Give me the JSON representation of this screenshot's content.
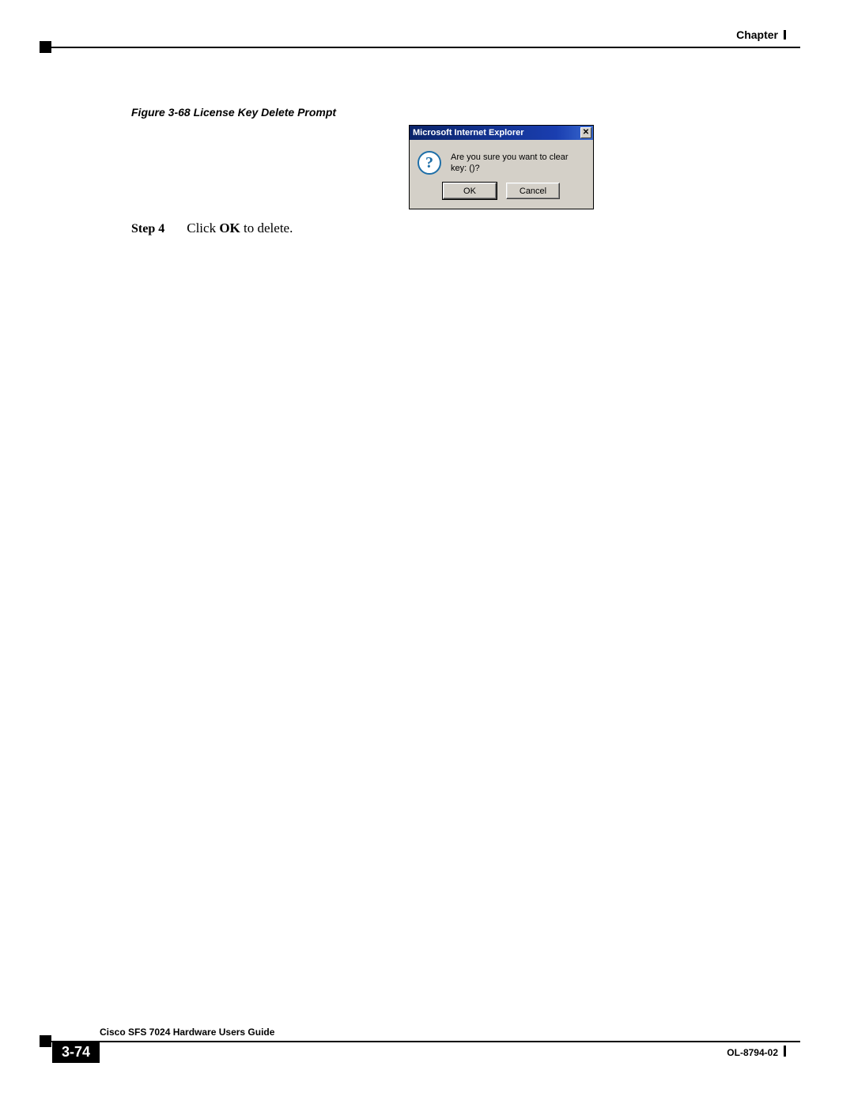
{
  "header": {
    "chapter_label": "Chapter"
  },
  "figure": {
    "caption": "Figure 3-68   License Key Delete Prompt"
  },
  "dialog": {
    "title": "Microsoft Internet Explorer",
    "close_glyph": "✕",
    "question_mark": "?",
    "message": "Are you sure you want to clear key: ()?",
    "ok_label": "OK",
    "cancel_label": "Cancel"
  },
  "step": {
    "label": "Step 4",
    "text_prefix": "Click ",
    "text_bold": "OK",
    "text_suffix": " to delete."
  },
  "footer": {
    "guide": "Cisco SFS 7024 Hardware Users Guide",
    "page_num": "3-74",
    "doc_id": "OL-8794-02"
  }
}
